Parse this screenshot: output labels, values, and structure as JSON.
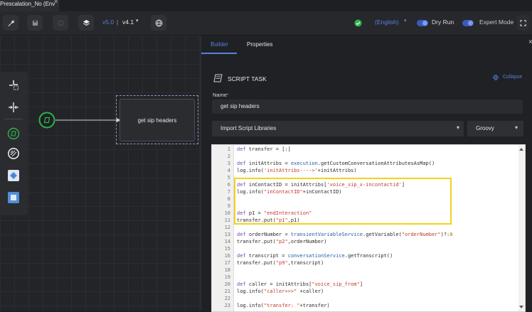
{
  "tab": {
    "title": "Prescalation_No (Env",
    "close": "×"
  },
  "toolbar": {
    "version_current": "v5.0",
    "version_separator": "|",
    "version_selected": "v4.1",
    "language": "(English)",
    "dry_run_label": "Dry Run",
    "expert_mode_label": "Expert Mode"
  },
  "canvas": {
    "node_label": "get sip headers"
  },
  "panel": {
    "tabs": [
      "Builder",
      "Properties"
    ],
    "close": "×",
    "section_title": "SCRIPT TASK",
    "collapse_label": "Collapse",
    "name_label": "Name",
    "name_required": "*",
    "name_value": "get sip headers",
    "import_libraries_label": "Import Script Libraries",
    "language_value": "Groovy"
  },
  "editor": {
    "lines": [
      {
        "n": "1",
        "text": "def transfer = [:]"
      },
      {
        "n": "2",
        "text": ""
      },
      {
        "n": "3",
        "text": "def initAttribs = execution.getCustomConversationAttributesAsMap()"
      },
      {
        "n": "4",
        "text": "log.info('initAttribs---->'+initAttribs)"
      },
      {
        "n": "5",
        "text": ""
      },
      {
        "n": "6",
        "text": "def inContactID = initAttribs['voice_sip_x-incontactid']"
      },
      {
        "n": "7",
        "text": "log.info(\"inContactID\"+inContactID)"
      },
      {
        "n": "8",
        "text": ""
      },
      {
        "n": "9",
        "text": ""
      },
      {
        "n": "10",
        "text": "def p1 = \"endInteraction\""
      },
      {
        "n": "11",
        "text": "transfer.put(\"p1\",p1)"
      },
      {
        "n": "12",
        "text": ""
      },
      {
        "n": "13",
        "text": "def orderNumber = transientVariableService.getVariable(\"orderNumber\")?:0"
      },
      {
        "n": "14",
        "text": "transfer.put(\"p2\",orderNumber)"
      },
      {
        "n": "15",
        "text": ""
      },
      {
        "n": "16",
        "text": "def transcript = conversationService.getTranscript()"
      },
      {
        "n": "17",
        "text": "transfer.put(\"p9\",transcript)"
      },
      {
        "n": "18",
        "text": ""
      },
      {
        "n": "19",
        "text": ""
      },
      {
        "n": "20",
        "text": "def caller = initAttribs[\"voice_sip_from\"]"
      },
      {
        "n": "21",
        "text": "log.info(\"caller>>>\" +caller)"
      },
      {
        "n": "22",
        "text": ""
      },
      {
        "n": "23",
        "text": "log.info(\"transfer: \"+transfer)"
      }
    ]
  },
  "colors": {
    "accent": "#5b7fe0",
    "status_ok": "#2fb24c",
    "highlight": "#f2d21b",
    "required": "#e05555"
  }
}
